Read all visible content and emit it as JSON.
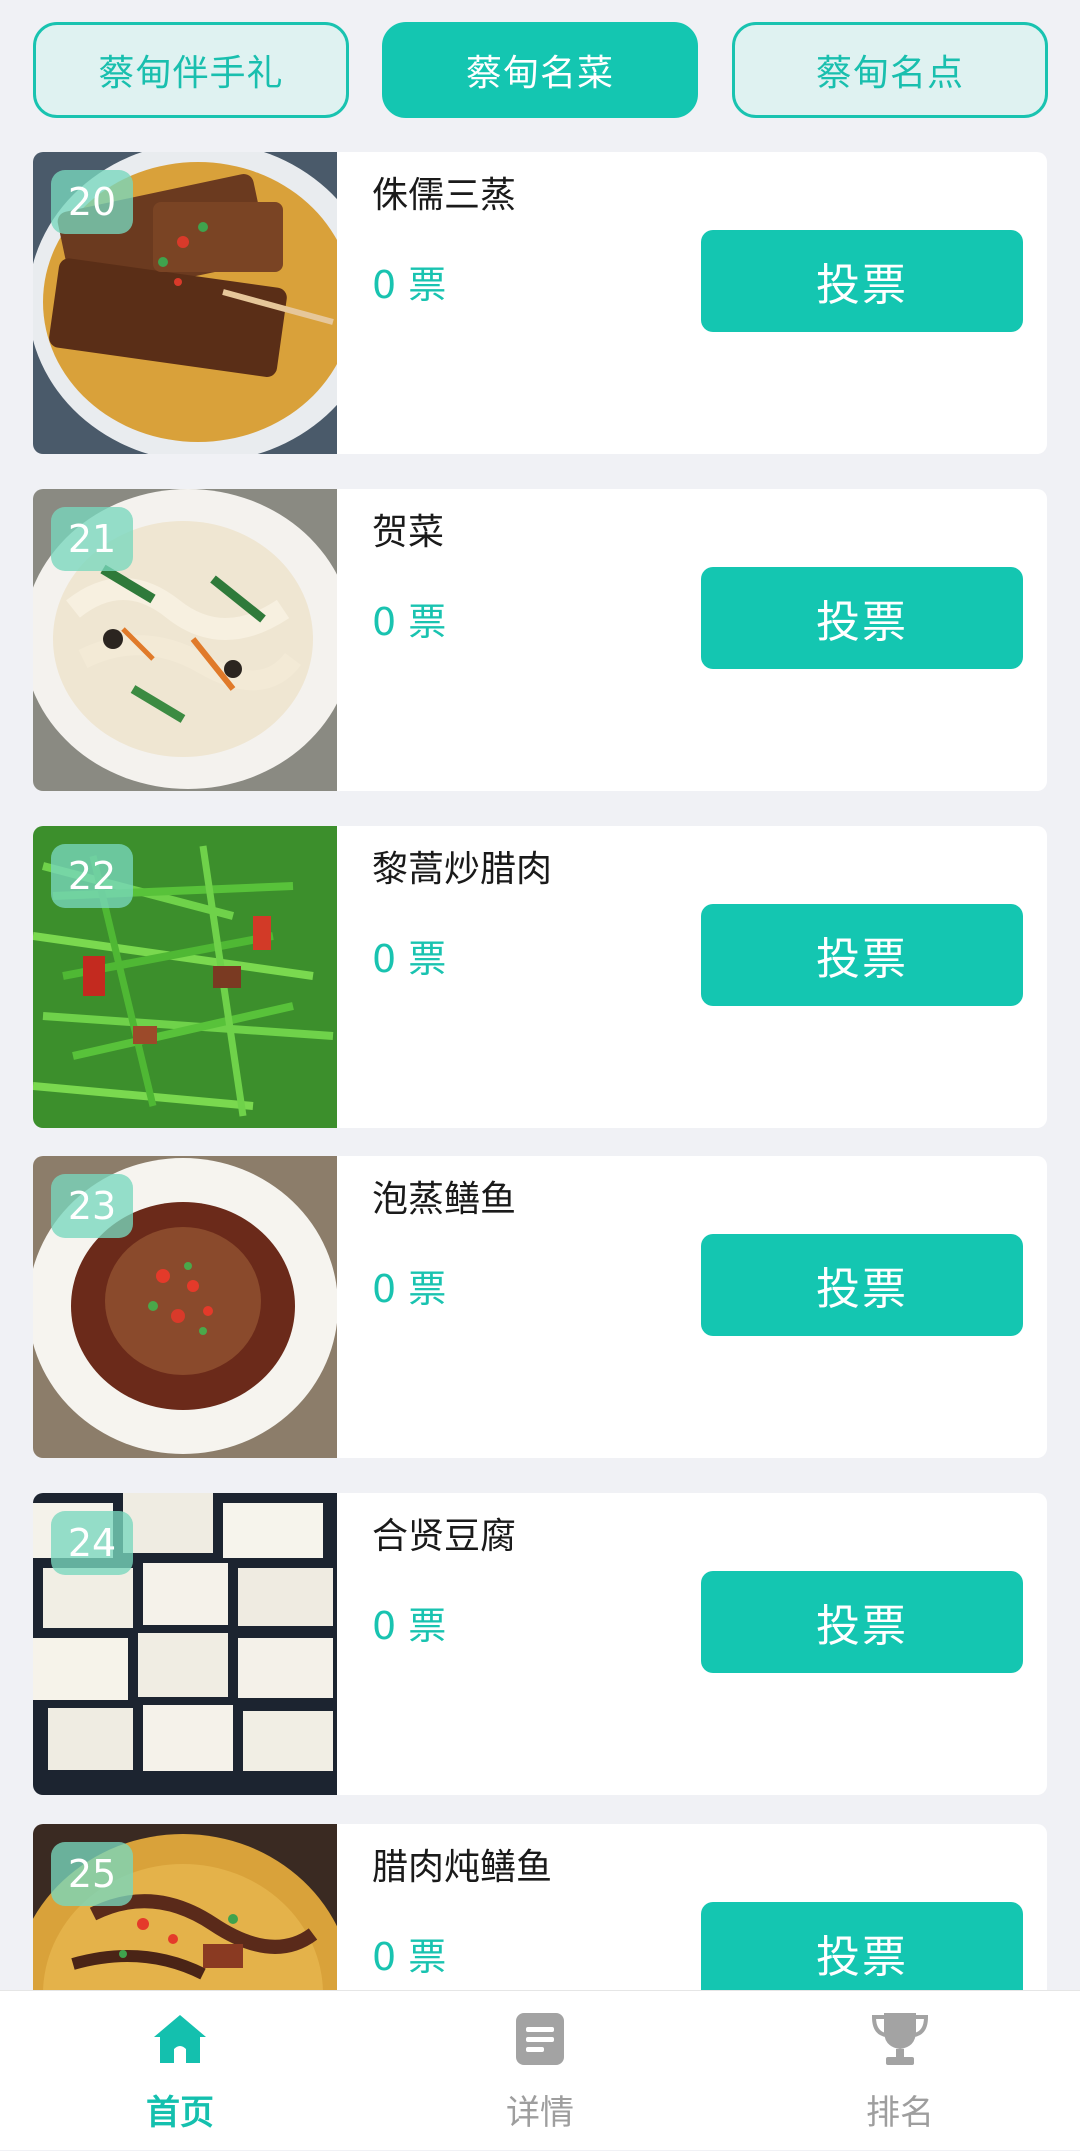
{
  "tabs": [
    {
      "label": "蔡甸伴手礼",
      "active": false
    },
    {
      "label": "蔡甸名菜",
      "active": true
    },
    {
      "label": "蔡甸名点",
      "active": false
    }
  ],
  "items": [
    {
      "num": "20",
      "name": "侏儒三蒸",
      "votes": "0 票",
      "button": "投票"
    },
    {
      "num": "21",
      "name": "贺菜",
      "votes": "0 票",
      "button": "投票"
    },
    {
      "num": "22",
      "name": "黎蒿炒腊肉",
      "votes": "0 票",
      "button": "投票"
    },
    {
      "num": "23",
      "name": "泡蒸鳝鱼",
      "votes": "0 票",
      "button": "投票"
    },
    {
      "num": "24",
      "name": "合贤豆腐",
      "votes": "0 票",
      "button": "投票"
    },
    {
      "num": "25",
      "name": "腊肉炖鳝鱼",
      "votes": "0 票",
      "button": "投票"
    }
  ],
  "nav": [
    {
      "label": "首页",
      "icon": "home-icon",
      "active": true
    },
    {
      "label": "详情",
      "icon": "document-icon",
      "active": false
    },
    {
      "label": "排名",
      "icon": "trophy-icon",
      "active": false
    }
  ],
  "colors": {
    "accent": "#14c6b1",
    "background": "#f0f1f5",
    "inactive": "#9e9e9e"
  }
}
